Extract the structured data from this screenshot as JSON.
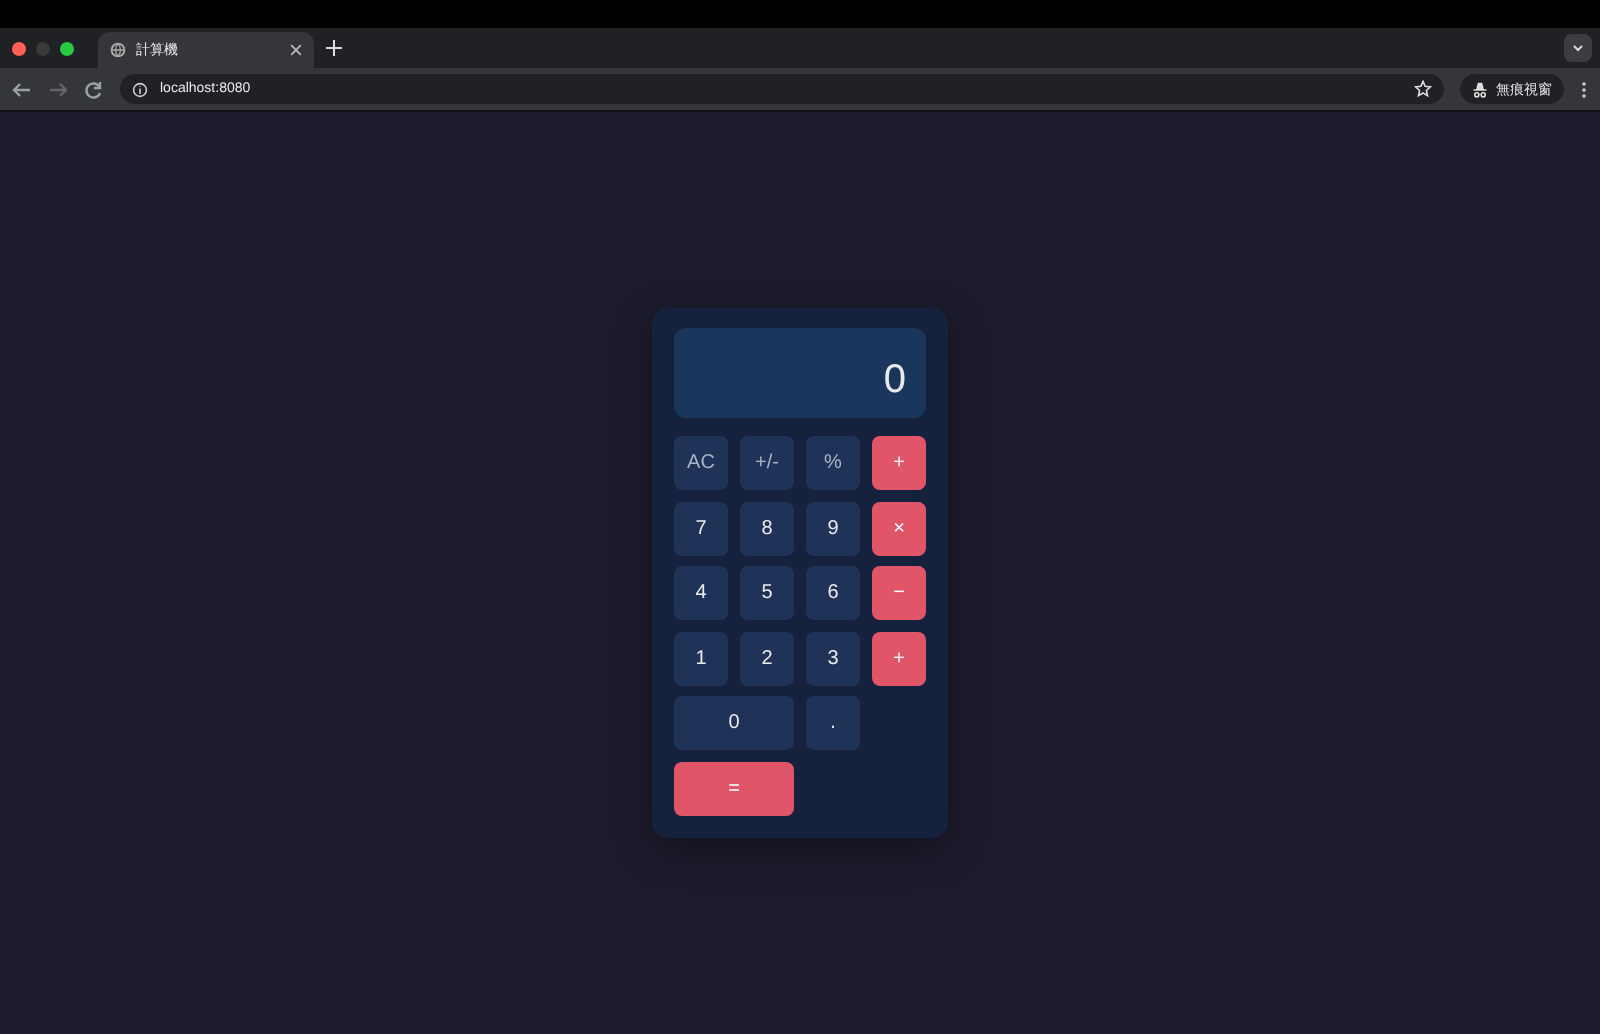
{
  "browser": {
    "tab_title": "計算機",
    "url": "localhost:8080",
    "profile_label": "無痕視窗"
  },
  "calculator": {
    "display": "0",
    "keys": [
      {
        "label": "AC",
        "kind": "function"
      },
      {
        "label": "+/-",
        "kind": "function"
      },
      {
        "label": "%",
        "kind": "function"
      },
      {
        "label": "+",
        "kind": "operator"
      },
      {
        "label": "7",
        "kind": "digit"
      },
      {
        "label": "8",
        "kind": "digit"
      },
      {
        "label": "9",
        "kind": "digit"
      },
      {
        "label": "×",
        "kind": "operator"
      },
      {
        "label": "4",
        "kind": "digit"
      },
      {
        "label": "5",
        "kind": "digit"
      },
      {
        "label": "6",
        "kind": "digit"
      },
      {
        "label": "−",
        "kind": "operator"
      },
      {
        "label": "1",
        "kind": "digit"
      },
      {
        "label": "2",
        "kind": "digit"
      },
      {
        "label": "3",
        "kind": "digit"
      },
      {
        "label": "+",
        "kind": "operator"
      },
      {
        "label": "0",
        "kind": "wide_digit"
      },
      {
        "label": ".",
        "kind": "digit"
      },
      {
        "label": "=",
        "kind": "wide_operator"
      }
    ]
  }
}
